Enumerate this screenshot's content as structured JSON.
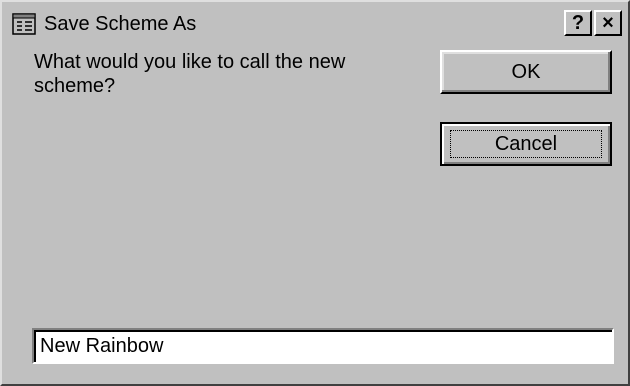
{
  "window": {
    "title": "Save Scheme As",
    "help_label": "?",
    "close_label": "×"
  },
  "dialog": {
    "prompt": "What would you like to call the new scheme?",
    "ok_label": "OK",
    "cancel_label": "Cancel",
    "scheme_name_value": "New Rainbow"
  },
  "icons": {
    "title_icon": "scheme-window-icon",
    "help_icon": "help-icon",
    "close_icon": "close-icon"
  },
  "colors": {
    "dialog_face": "#c0c0c0",
    "input_background": "#ffffff",
    "text": "#000000"
  }
}
